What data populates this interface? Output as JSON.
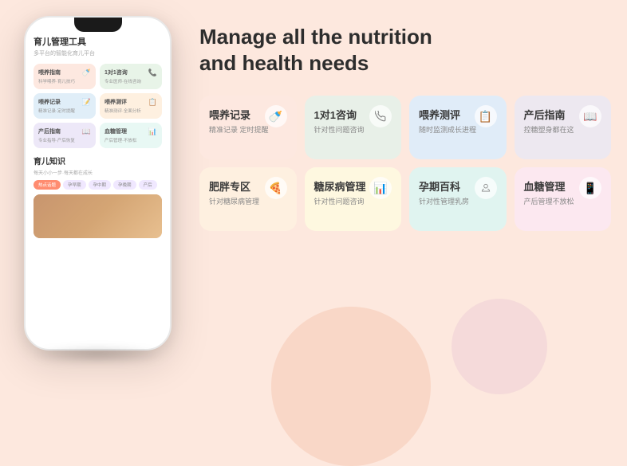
{
  "background": {
    "color": "#fde8de"
  },
  "phone": {
    "title": "育儿管理工具",
    "subtitle": "多平台的智能化育儿平台",
    "cards": [
      {
        "title": "喂养指南",
        "sub": "科学喂养·育儿技巧",
        "color": "pink",
        "icon": "🍼"
      },
      {
        "title": "1对1咨询",
        "sub": "专业医师·在线咨询",
        "color": "green",
        "icon": "📞"
      },
      {
        "title": "喂养记录",
        "sub": "精准记录·定时提醒",
        "color": "blue",
        "icon": "📝"
      },
      {
        "title": "喂养测评",
        "sub": "精准测评·全面分析",
        "color": "peach",
        "icon": "📋"
      },
      {
        "title": "产后指南",
        "sub": "专业指导·产后恢复",
        "color": "lavender",
        "icon": "📖"
      },
      {
        "title": "血糖管理",
        "sub": "产后管理·不放松",
        "color": "mint",
        "icon": "📊"
      }
    ],
    "knowledge": {
      "title": "育儿知识",
      "subtitle": "每天小小一步·每天都在成长",
      "tags": [
        "热点话题",
        "孕早期",
        "孕中期",
        "孕晚期",
        "产后"
      ]
    }
  },
  "heading": {
    "line1": "Manage all the nutrition",
    "line2": "and health needs"
  },
  "feature_cards_row1": [
    {
      "title": "喂养记录",
      "desc": "精准记录 定时提醒",
      "color": "salmon",
      "icon": "🍼"
    },
    {
      "title": "1对1咨询",
      "desc": "针对性问题咨询",
      "color": "green",
      "icon": "📞"
    },
    {
      "title": "喂养测评",
      "desc": "随时监测成长进程",
      "color": "blue",
      "icon": "📋"
    },
    {
      "title": "产后指南",
      "desc": "控糖塑身都在这",
      "color": "lavender",
      "icon": "📖"
    }
  ],
  "feature_cards_row2": [
    {
      "title": "肥胖专区",
      "desc": "针对糖尿病管理",
      "color": "peach",
      "icon": "🍕"
    },
    {
      "title": "糖尿病管理",
      "desc": "针对性问题咨询",
      "color": "yellow",
      "icon": "📊"
    },
    {
      "title": "孕期百科",
      "desc": "针对性管理乳房",
      "color": "mint",
      "icon": "🌸"
    },
    {
      "title": "血糖管理",
      "desc": "产后管理不放松",
      "color": "pink",
      "icon": "📱"
    }
  ]
}
